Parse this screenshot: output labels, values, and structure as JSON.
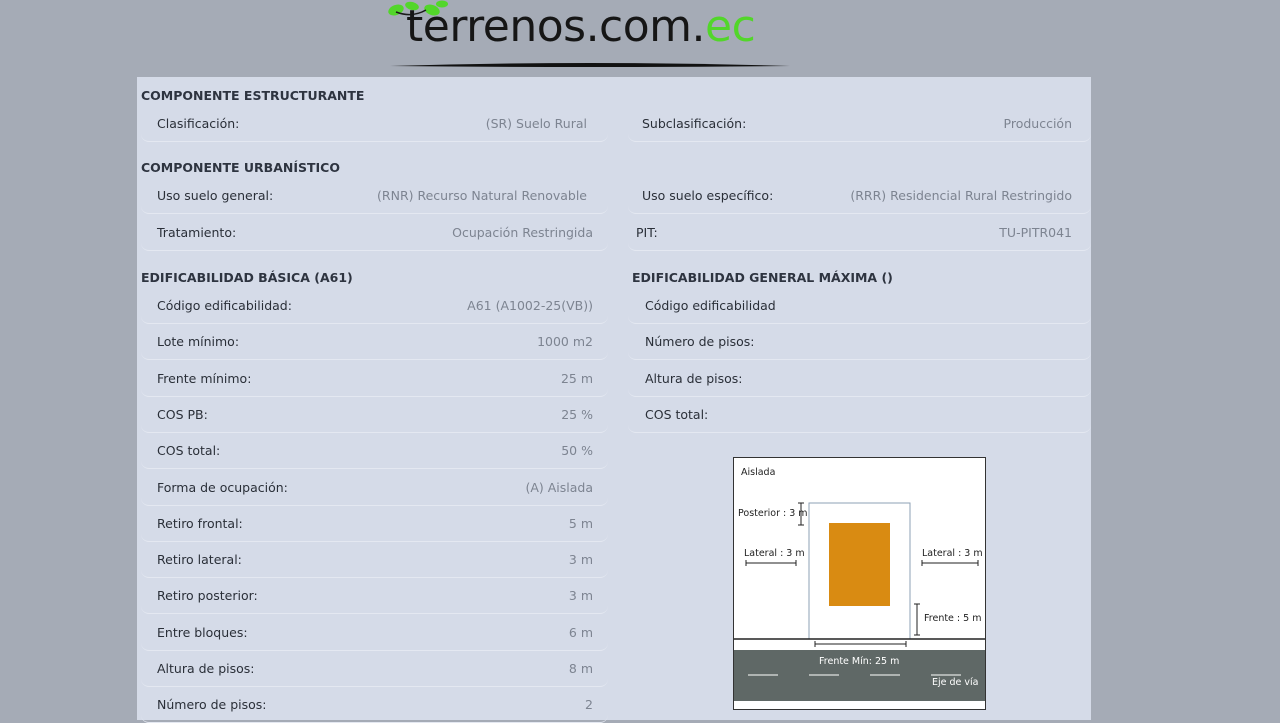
{
  "brand": {
    "logo_main": "terrenos.com",
    "logo_ext": "ec",
    "accent_color": "#52d62a"
  },
  "estructurante": {
    "heading": "COMPONENTE ESTRUCTURANTE",
    "clasificacion": {
      "label": "Clasificación:",
      "value": "(SR) Suelo Rural"
    },
    "subclasificacion": {
      "label": "Subclasificación:",
      "value": "Producción"
    }
  },
  "urbanistico": {
    "heading": "COMPONENTE URBANÍSTICO",
    "uso_general": {
      "label": "Uso suelo general:",
      "value": "(RNR) Recurso Natural Renovable"
    },
    "uso_especifico": {
      "label": "Uso suelo específico:",
      "value": "(RRR) Residencial Rural Restringido"
    },
    "tratamiento": {
      "label": "Tratamiento:",
      "value": "Ocupación Restringida"
    },
    "pit": {
      "label": "PIT:",
      "value": "TU-PITR041"
    }
  },
  "basica": {
    "heading": "EDIFICABILIDAD BÁSICA (A61)",
    "rows": [
      {
        "label": "Código edificabilidad:",
        "value": "A61 (A1002-25(VB))"
      },
      {
        "label": "Lote mínimo:",
        "value": "1000 m2"
      },
      {
        "label": "Frente mínimo:",
        "value": "25 m"
      },
      {
        "label": "COS PB:",
        "value": "25 %"
      },
      {
        "label": "COS total:",
        "value": "50 %"
      },
      {
        "label": "Forma de ocupación:",
        "value": "(A) Aislada"
      },
      {
        "label": "Retiro frontal:",
        "value": "5 m"
      },
      {
        "label": "Retiro lateral:",
        "value": "3 m"
      },
      {
        "label": "Retiro posterior:",
        "value": "3 m"
      },
      {
        "label": "Entre bloques:",
        "value": "6 m"
      },
      {
        "label": "Altura de pisos:",
        "value": "8 m"
      },
      {
        "label": "Número de pisos:",
        "value": "2"
      }
    ]
  },
  "maxima": {
    "heading": "EDIFICABILIDAD GENERAL MÁXIMA ()",
    "rows": [
      {
        "label": "Código edificabilidad",
        "value": ""
      },
      {
        "label": "Número de pisos:",
        "value": ""
      },
      {
        "label": "Altura de pisos:",
        "value": ""
      },
      {
        "label": "COS total:",
        "value": ""
      }
    ]
  },
  "diagram": {
    "title": "Aislada",
    "posterior": "Posterior : 3 m",
    "lateral_left": "Lateral : 3 m",
    "lateral_right": "Lateral : 3 m",
    "frente": "Frente : 5 m",
    "frente_min": "Frente Mín: 25 m",
    "eje": "Eje de vía",
    "building_color": "#d98b12",
    "road_color": "#5f6866"
  }
}
